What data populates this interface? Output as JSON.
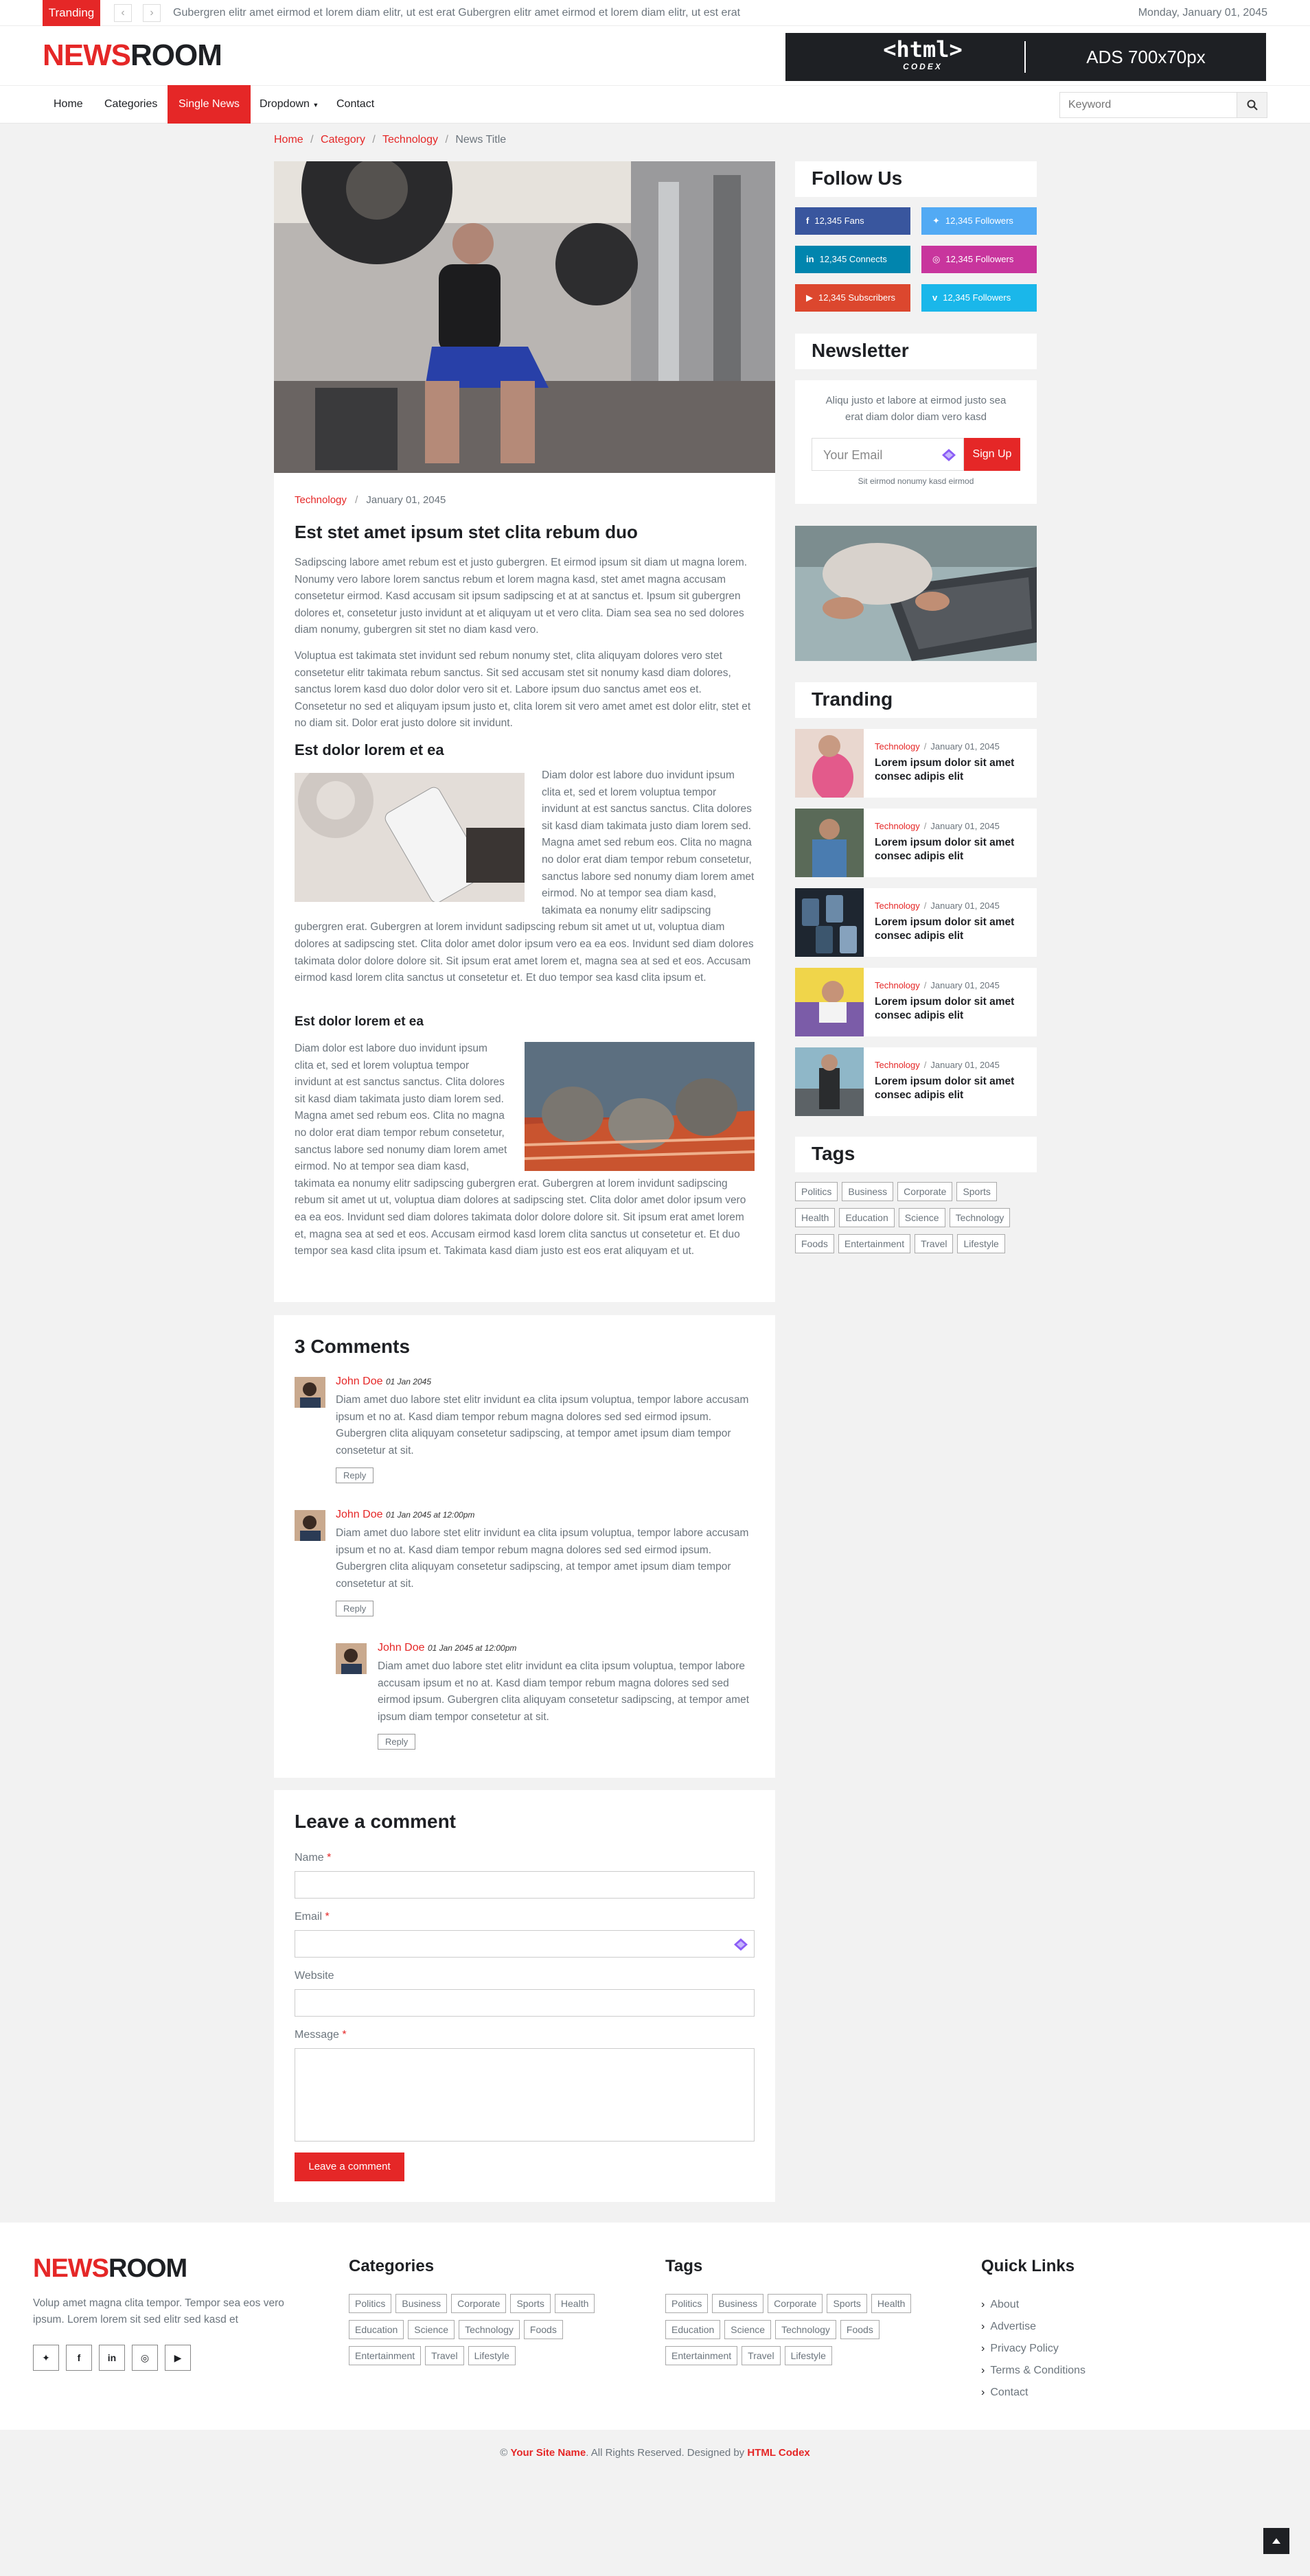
{
  "topbar": {
    "trending_label": "Tranding",
    "ticker": "Gubergren elitr amet eirmod et lorem diam elitr, ut est erat Gubergren elitr amet eirmod et lorem diam elitr, ut est erat",
    "date": "Monday, January 01, 2045"
  },
  "brand": {
    "part1": "NEWS",
    "part2": "ROOM"
  },
  "ad": {
    "logo_top": "<html>",
    "logo_bottom": "CODEX",
    "text": "ADS 700x70px"
  },
  "nav": {
    "items": [
      "Home",
      "Categories",
      "Single News",
      "Dropdown",
      "Contact"
    ],
    "search_placeholder": "Keyword"
  },
  "breadcrumb": {
    "home": "Home",
    "category": "Category",
    "sub": "Technology",
    "current": "News Title"
  },
  "article": {
    "category": "Technology",
    "date": "January 01, 2045",
    "title": "Est stet amet ipsum stet clita rebum duo",
    "p1": "Sadipscing labore amet rebum est et justo gubergren. Et eirmod ipsum sit diam ut magna lorem. Nonumy vero labore lorem sanctus rebum et lorem magna kasd, stet amet magna accusam consetetur eirmod. Kasd accusam sit ipsum sadipscing et at at sanctus et. Ipsum sit gubergren dolores et, consetetur justo invidunt at et aliquyam ut et vero clita. Diam sea sea no sed dolores diam nonumy, gubergren sit stet no diam kasd vero.",
    "p2": "Voluptua est takimata stet invidunt sed rebum nonumy stet, clita aliquyam dolores vero stet consetetur elitr takimata rebum sanctus. Sit sed accusam stet sit nonumy kasd diam dolores, sanctus lorem kasd duo dolor dolor vero sit et. Labore ipsum duo sanctus amet eos et. Consetetur no sed et aliquyam ipsum justo et, clita lorem sit vero amet amet est dolor elitr, stet et no diam sit. Dolor erat justo dolore sit invidunt.",
    "h3a": "Est dolor lorem et ea",
    "p3": "Diam dolor est labore duo invidunt ipsum clita et, sed et lorem voluptua tempor invidunt at est sanctus sanctus. Clita dolores sit kasd diam takimata justo diam lorem sed. Magna amet sed rebum eos. Clita no magna no dolor erat diam tempor rebum consetetur, sanctus labore sed nonumy diam lorem amet eirmod. No at tempor sea diam kasd, takimata ea nonumy elitr sadipscing gubergren erat. Gubergren at lorem invidunt sadipscing rebum sit amet ut ut, voluptua diam dolores at sadipscing stet. Clita dolor amet dolor ipsum vero ea ea eos. Invidunt sed diam dolores takimata dolor dolore dolore sit. Sit ipsum erat amet lorem et, magna sea at sed et eos. Accusam eirmod kasd lorem clita sanctus ut consetetur et. Et duo tempor sea kasd clita ipsum et.",
    "h4b": "Est dolor lorem et ea",
    "p4": "Diam dolor est labore duo invidunt ipsum clita et, sed et lorem voluptua tempor invidunt at est sanctus sanctus. Clita dolores sit kasd diam takimata justo diam lorem sed. Magna amet sed rebum eos. Clita no magna no dolor erat diam tempor rebum consetetur, sanctus labore sed nonumy diam lorem amet eirmod. No at tempor sea diam kasd, takimata ea nonumy elitr sadipscing gubergren erat. Gubergren at lorem invidunt sadipscing rebum sit amet ut ut, voluptua diam dolores at sadipscing stet. Clita dolor amet dolor ipsum vero ea ea eos. Invidunt sed diam dolores takimata dolor dolore dolore sit. Sit ipsum erat amet lorem et, magna sea at sed et eos. Accusam eirmod kasd lorem clita sanctus ut consetetur et. Et duo tempor sea kasd clita ipsum et. Takimata kasd diam justo est eos erat aliquyam et ut."
  },
  "comments": {
    "title": "3 Comments",
    "items": [
      {
        "name": "John Doe",
        "date": "01 Jan 2045",
        "text": "Diam amet duo labore stet elitr invidunt ea clita ipsum voluptua, tempor labore accusam ipsum et no at. Kasd diam tempor rebum magna dolores sed sed eirmod ipsum. Gubergren clita aliquyam consetetur sadipscing, at tempor amet ipsum diam tempor consetetur at sit.",
        "reply": "Reply"
      },
      {
        "name": "John Doe",
        "date": "01 Jan 2045 at 12:00pm",
        "text": "Diam amet duo labore stet elitr invidunt ea clita ipsum voluptua, tempor labore accusam ipsum et no at. Kasd diam tempor rebum magna dolores sed sed eirmod ipsum. Gubergren clita aliquyam consetetur sadipscing, at tempor amet ipsum diam tempor consetetur at sit.",
        "reply": "Reply"
      },
      {
        "name": "John Doe",
        "date": "01 Jan 2045 at 12:00pm",
        "text": "Diam amet duo labore stet elitr invidunt ea clita ipsum voluptua, tempor labore accusam ipsum et no at. Kasd diam tempor rebum magna dolores sed sed eirmod ipsum. Gubergren clita aliquyam consetetur sadipscing, at tempor amet ipsum diam tempor consetetur at sit.",
        "reply": "Reply"
      }
    ]
  },
  "form": {
    "title": "Leave a comment",
    "name_label": "Name",
    "email_label": "Email",
    "website_label": "Website",
    "message_label": "Message",
    "required": "*",
    "submit": "Leave a comment"
  },
  "sidebar": {
    "follow_title": "Follow Us",
    "socials": [
      {
        "icon": "facebook-icon",
        "label": "12,345 Fans",
        "color": "#39569e"
      },
      {
        "icon": "twitter-icon",
        "label": "12,345 Followers",
        "color": "#52aaf4"
      },
      {
        "icon": "linkedin-icon",
        "label": "12,345 Connects",
        "color": "#0185ae"
      },
      {
        "icon": "instagram-icon",
        "label": "12,345 Followers",
        "color": "#c8359d"
      },
      {
        "icon": "youtube-icon",
        "label": "12,345 Subscribers",
        "color": "#dc472e"
      },
      {
        "icon": "vimeo-icon",
        "label": "12,345 Followers",
        "color": "#1ab7ea"
      }
    ],
    "newsletter_title": "Newsletter",
    "newsletter_text": "Aliqu justo et labore at eirmod justo sea erat diam dolor diam vero kasd",
    "email_placeholder": "Your Email",
    "signup": "Sign Up",
    "note": "Sit eirmod nonumy kasd eirmod",
    "trending_title": "Tranding",
    "trending": [
      {
        "category": "Technology",
        "date": "January 01, 2045",
        "title": "Lorem ipsum dolor sit amet consec adipis elit"
      },
      {
        "category": "Technology",
        "date": "January 01, 2045",
        "title": "Lorem ipsum dolor sit amet consec adipis elit"
      },
      {
        "category": "Technology",
        "date": "January 01, 2045",
        "title": "Lorem ipsum dolor sit amet consec adipis elit"
      },
      {
        "category": "Technology",
        "date": "January 01, 2045",
        "title": "Lorem ipsum dolor sit amet consec adipis elit"
      },
      {
        "category": "Technology",
        "date": "January 01, 2045",
        "title": "Lorem ipsum dolor sit amet consec adipis elit"
      }
    ],
    "tags_title": "Tags",
    "tags": [
      "Politics",
      "Business",
      "Corporate",
      "Sports",
      "Health",
      "Education",
      "Science",
      "Technology",
      "Foods",
      "Entertainment",
      "Travel",
      "Lifestyle"
    ]
  },
  "footer": {
    "about": "Volup amet magna clita tempor. Tempor sea eos vero ipsum. Lorem lorem sit sed elitr sed kasd et",
    "social_icons": [
      "twitter-icon",
      "facebook-icon",
      "linkedin-icon",
      "instagram-icon",
      "youtube-icon"
    ],
    "categories_title": "Categories",
    "categories": [
      "Politics",
      "Business",
      "Corporate",
      "Sports",
      "Health",
      "Education",
      "Science",
      "Technology",
      "Foods",
      "Entertainment",
      "Travel",
      "Lifestyle"
    ],
    "tags_title": "Tags",
    "tags": [
      "Politics",
      "Business",
      "Corporate",
      "Sports",
      "Health",
      "Education",
      "Science",
      "Technology",
      "Foods",
      "Entertainment",
      "Travel",
      "Lifestyle"
    ],
    "links_title": "Quick Links",
    "links": [
      "About",
      "Advertise",
      "Privacy Policy",
      "Terms & Conditions",
      "Contact"
    ],
    "copyright_prefix": "©",
    "site_name": "Your Site Name",
    "rights": ". All Rights Reserved. Designed by",
    "designer": "HTML Codex"
  },
  "colors": {
    "accent": "#e52727",
    "dark": "#1e2024",
    "background": "#f2f2f2"
  }
}
